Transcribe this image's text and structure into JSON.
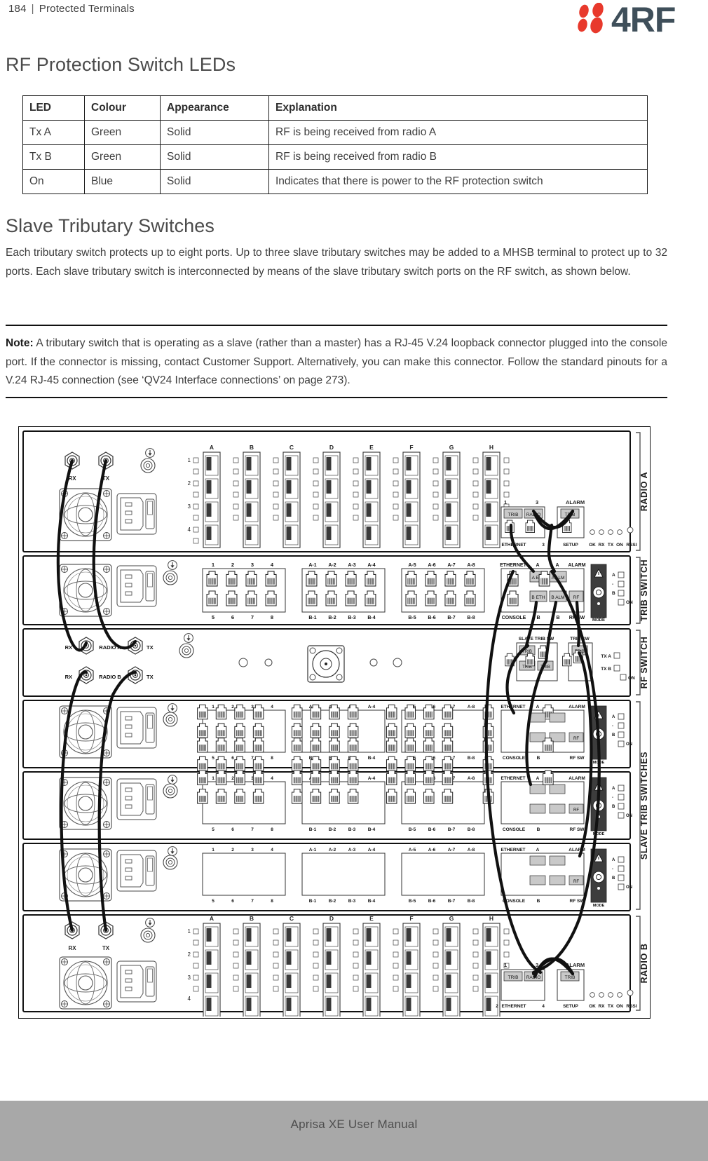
{
  "header": {
    "page_number": "184",
    "separator": "|",
    "section_title": "Protected Terminals",
    "logo_text": "4RF",
    "logo_red": "#e8392c",
    "logo_dark": "#3f4f5a"
  },
  "headings": {
    "leds": "RF Protection Switch LEDs",
    "slave": "Slave Tributary Switches"
  },
  "led_table": {
    "columns": [
      "LED",
      "Colour",
      "Appearance",
      "Explanation"
    ],
    "rows": [
      [
        "Tx A",
        "Green",
        "Solid",
        "RF is being received from radio A"
      ],
      [
        "Tx B",
        "Green",
        "Solid",
        "RF is being received from radio B"
      ],
      [
        "On",
        "Blue",
        "Solid",
        "Indicates that there is power to the RF protection switch"
      ]
    ]
  },
  "paragraphs": {
    "slave_intro": "Each tributary switch protects up to eight ports. Up to three slave tributary switches may be added to a MHSB terminal to protect up to 32 ports. Each slave tributary switch is interconnected by means of the slave tributary switch ports on the RF switch, as shown below."
  },
  "note": {
    "label": "Note:",
    "text": " A tributary switch that is operating as a slave (rather than a master) has a RJ-45 V.24 loopback connector plugged into the console port. If the connector is missing, contact Customer Support. Alternatively, you can make this connector. Follow the standard pinouts for a V.24 RJ-45 connection (see ‘QV24 Interface connections’ on page 273)."
  },
  "diagram": {
    "group_labels": [
      "RADIO A",
      "TRIB SWITCH",
      "RF SWITCH",
      "SLAVE TRIB SWITCHES",
      "RADIO B"
    ],
    "radio": {
      "rx_label": "RX",
      "tx_label": "TX",
      "port_bank_letters": [
        "A",
        "B",
        "C",
        "D",
        "E",
        "F",
        "G",
        "H"
      ],
      "row_numbers": [
        "1",
        "2",
        "3",
        "4"
      ],
      "eth_port_left_num": "1",
      "eth_port_right_num": "3",
      "alarm_label": "ALARM",
      "trib_label": "TRIB",
      "radio_label": "RADIO",
      "ethernet_label": "ETHERNET",
      "setup_label": "SETUP",
      "led_labels": [
        "OK",
        "RX",
        "TX",
        "ON",
        "RSSI"
      ],
      "radio_b_eth_left_num": "2",
      "radio_b_eth_right_num": "4"
    },
    "trib_switch": {
      "top_port_numbers": [
        "1",
        "2",
        "3",
        "4"
      ],
      "bottom_port_numbers": [
        "5",
        "6",
        "7",
        "8"
      ],
      "a_group_1": [
        "A-1",
        "A-2",
        "A-3",
        "A-4"
      ],
      "a_group_2": [
        "A-5",
        "A-6",
        "A-7",
        "A-8"
      ],
      "b_group_1": [
        "B-1",
        "B-2",
        "B-3",
        "B-4"
      ],
      "b_group_2": [
        "B-5",
        "B-6",
        "B-7",
        "B-8"
      ],
      "ethernet_label": "ETHERNET",
      "console_label": "CONSOLE",
      "a_label": "A",
      "b_label": "B",
      "alarm_label": "ALARM",
      "rf_sw_label": "RF SW",
      "a_eth": "A ETH",
      "a_alm": "A ALM",
      "b_eth": "B ETH",
      "b_alm": "B ALM",
      "rf": "RF",
      "mode_label": "MODE",
      "led_a": "A",
      "led_dash": "-",
      "led_b": "B",
      "led_on": "ON"
    },
    "rf_switch": {
      "rx_label": "RX",
      "tx_label": "TX",
      "radio_a_label": "RADIO A",
      "radio_b_label": "RADIO B",
      "slave_trib_sw_label": "SLAVE TRIB SW",
      "trib_sw_label": "TRIB SW",
      "trib_label": "TRIB",
      "tx_a_label": "TX A",
      "tx_b_label": "TX B",
      "on_label": "ON"
    }
  },
  "footer": {
    "text": "Aprisa XE User Manual",
    "band_color": "#a8a8a8"
  }
}
